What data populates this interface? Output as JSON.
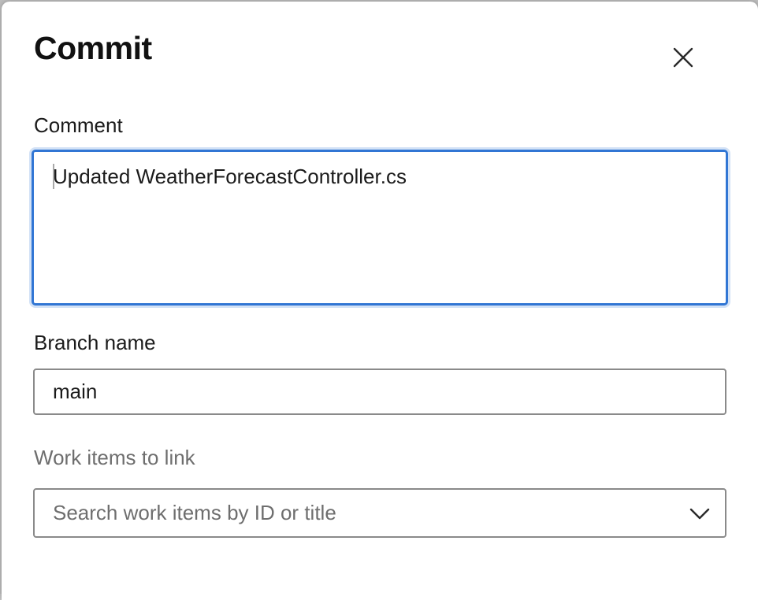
{
  "dialog": {
    "title": "Commit",
    "close_icon": "close-icon"
  },
  "comment": {
    "label": "Comment",
    "value": "Updated WeatherForecastController.cs"
  },
  "branch": {
    "label": "Branch name",
    "value": "main"
  },
  "work_items": {
    "label": "Work items to link",
    "placeholder": "Search work items by ID or title",
    "dropdown_icon": "chevron-down-icon"
  },
  "colors": {
    "focus_border": "#3176d4",
    "focus_ring": "#d3e2f6",
    "muted_text": "#6e6e6e"
  }
}
